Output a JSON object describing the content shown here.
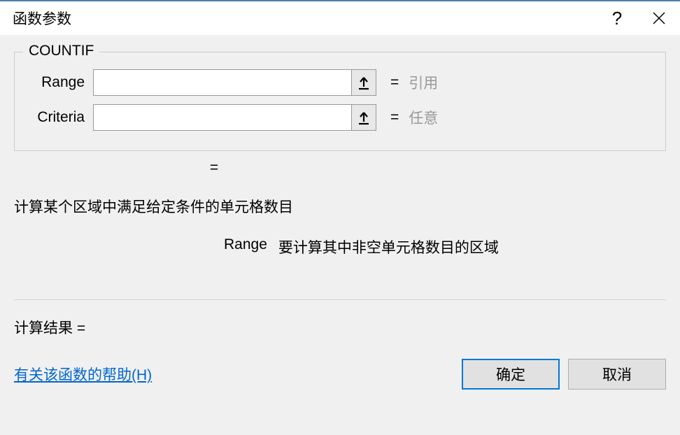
{
  "dialog": {
    "title": "函数参数"
  },
  "function": {
    "name": "COUNTIF",
    "params": [
      {
        "label": "Range",
        "value": "",
        "resultHint": "引用"
      },
      {
        "label": "Criteria",
        "value": "",
        "resultHint": "任意"
      }
    ],
    "formulaResultPrefix": "=",
    "equalsSign": "=",
    "description": "计算某个区域中满足给定条件的单元格数目",
    "paramDescLabel": "Range",
    "paramDescText": "要计算其中非空单元格数目的区域",
    "calcResultLabel": "计算结果 ="
  },
  "footer": {
    "helpLink": "有关该函数的帮助(H)",
    "okButton": "确定",
    "cancelButton": "取消"
  }
}
